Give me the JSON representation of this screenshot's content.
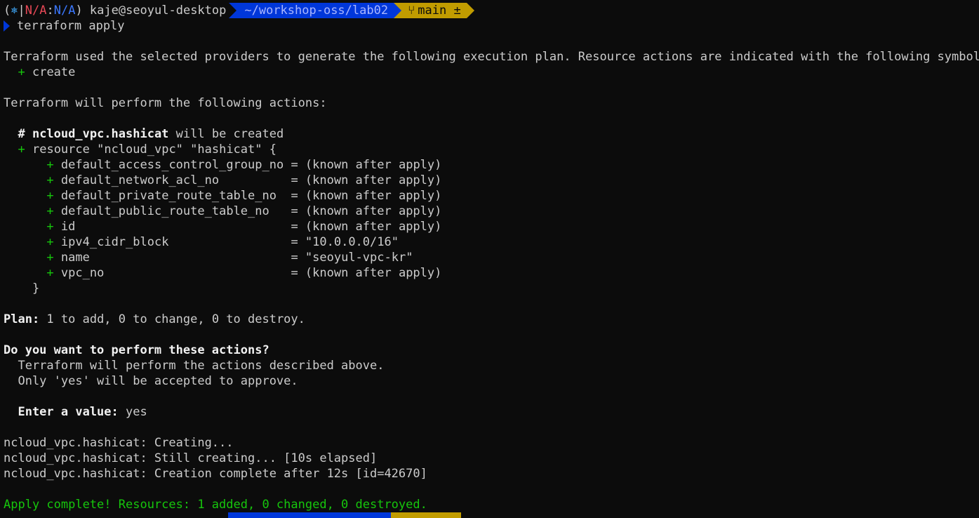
{
  "prompt": {
    "open_paren": "(",
    "k8s_icon": "⎈",
    "sep1": "|",
    "context": "N/A",
    "colon": ":",
    "namespace": "N/A",
    "close_paren_user": ") kaje@seoyul-desktop",
    "path": "~/workshop-oss/lab02",
    "branch_icon": "git-branch-icon",
    "branch": "main ±",
    "command": "terraform apply"
  },
  "plan_intro": "Terraform used the selected providers to generate the following execution plan. Resource actions are indicated with the following symbols:",
  "symbol_plus": "+",
  "symbol_create": " create",
  "perform_header": "Terraform will perform the following actions:",
  "resource_comment_hash": "  # ",
  "resource_name": "ncloud_vpc.hashicat",
  "resource_comment_tail": " will be created",
  "resource_decl_plus": "  + ",
  "resource_decl": "resource \"ncloud_vpc\" \"hashicat\" {",
  "attributes": [
    {
      "name": "default_access_control_group_no",
      "value": "= (known after apply)"
    },
    {
      "name": "default_network_acl_no         ",
      "value": " = (known after apply)"
    },
    {
      "name": "default_private_route_table_no ",
      "value": " = (known after apply)"
    },
    {
      "name": "default_public_route_table_no  ",
      "value": " = (known after apply)"
    },
    {
      "name": "id                             ",
      "value": " = (known after apply)"
    },
    {
      "name": "ipv4_cidr_block                ",
      "value": " = \"10.0.0.0/16\""
    },
    {
      "name": "name                           ",
      "value": " = \"seoyul-vpc-kr\""
    },
    {
      "name": "vpc_no                         ",
      "value": " = (known after apply)"
    }
  ],
  "closing_brace": "    }",
  "plan_label": "Plan:",
  "plan_summary": " 1 to add, 0 to change, 0 to destroy.",
  "confirm_question": "Do you want to perform these actions?",
  "confirm_line1": "  Terraform will perform the actions described above.",
  "confirm_line2": "  Only 'yes' will be accepted to approve.",
  "enter_value_label": "  Enter a value:",
  "enter_value": " yes",
  "progress": [
    "ncloud_vpc.hashicat: Creating...",
    "ncloud_vpc.hashicat: Still creating... [10s elapsed]",
    "ncloud_vpc.hashicat: Creation complete after 12s [id=42670]"
  ],
  "apply_complete": "Apply complete! Resources: 1 added, 0 changed, 0 destroyed.",
  "colors": {
    "background": "#0c0c0c",
    "foreground": "#cccccc",
    "green": "#16c60c",
    "red": "#e74856",
    "blue": "#3b78ff",
    "path_bg": "#0037da",
    "git_bg": "#c19c00"
  }
}
